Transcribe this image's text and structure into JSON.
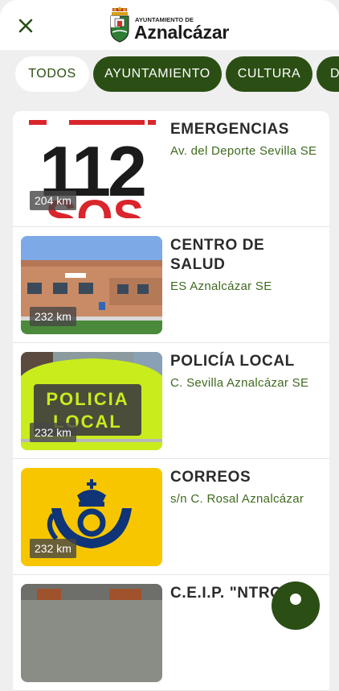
{
  "header": {
    "close_icon": "close-icon",
    "logo_small": "AYUNTAMIENTO DE",
    "logo_big": "Aznalcázar"
  },
  "filters": [
    {
      "label": "TODOS",
      "active": true
    },
    {
      "label": "AYUNTAMIENTO",
      "active": false
    },
    {
      "label": "CULTURA",
      "active": false
    },
    {
      "label": "D",
      "active": false
    }
  ],
  "places": [
    {
      "title": "EMERGENCIAS",
      "address": "Av. del Deporte Sevilla SE",
      "distance": "204 km",
      "image": "112 SOS emergency logo"
    },
    {
      "title": "CENTRO DE SALUD",
      "address": "ES Aznalcázar SE",
      "distance": "232 km",
      "image": "health center building"
    },
    {
      "title": "POLICÍA LOCAL",
      "address": "C. Sevilla Aznalcázar SE",
      "distance": "232 km",
      "image": "police officer back with vest"
    },
    {
      "title": "CORREOS",
      "address": "s/n C. Rosal Aznalcázar",
      "distance": "232 km",
      "image": "Correos post horn logo"
    },
    {
      "title": "C.E.I.P. \"NTRO",
      "address": "",
      "distance": "",
      "image": "school building"
    }
  ],
  "fab_icon": "location-icon"
}
